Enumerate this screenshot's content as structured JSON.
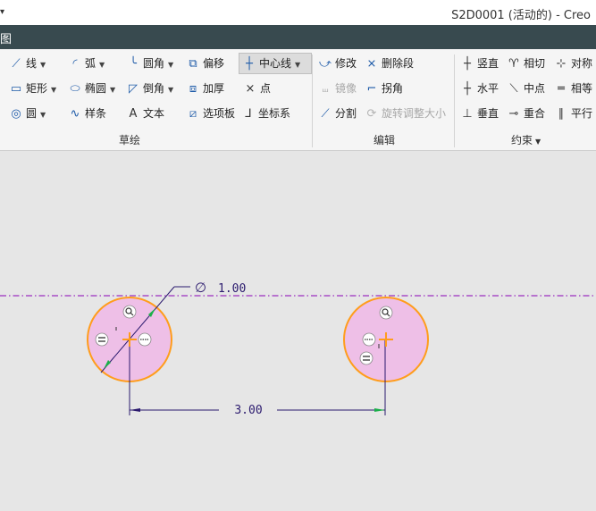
{
  "window": {
    "title": "S2D0001 (活动的) - Creo",
    "quick_access": "▾"
  },
  "menubar": {
    "tab_label": "图"
  },
  "ribbon": {
    "sketch": {
      "group_label": "草绘",
      "line": "线",
      "arc": "弧",
      "fillet": "圆角",
      "offset": "偏移",
      "centerline": "中心线",
      "rectangle": "矩形",
      "ellipse": "椭圆",
      "chamfer": "倒角",
      "thicken": "加厚",
      "point": "点",
      "circle": "圆",
      "spline": "样条",
      "text": "文本",
      "palette": "选项板",
      "coord_sys": "坐标系"
    },
    "edit": {
      "group_label": "编辑",
      "modify": "修改",
      "delete_segment": "删除段",
      "mirror": "镜像",
      "corner": "拐角",
      "divide": "分割",
      "rotate_resize": "旋转调整大小"
    },
    "constrain": {
      "group_label": "约束",
      "vertical": "竖直",
      "tangent": "相切",
      "symmetric": "对称",
      "horizontal": "水平",
      "midpoint": "中点",
      "equal": "相等",
      "perpendicular": "垂直",
      "coincident": "重合",
      "parallel": "平行"
    }
  },
  "sketch": {
    "diameter_dim": "1.00",
    "distance_dim": "3.00",
    "diameter_symbol": "∅",
    "colors": {
      "circle_fill": "#eebfe7",
      "circle_stroke": "#ff9d1c",
      "centerline": "#9b2fbf",
      "dimension": "#2b1a6e"
    }
  }
}
